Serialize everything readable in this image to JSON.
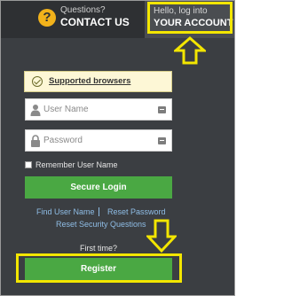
{
  "header": {
    "questions_label": "Questions?",
    "contact_label": "CONTACT US",
    "account_small": "Hello, log into",
    "account_big": "YOUR ACCOUNT"
  },
  "browsers": {
    "label": "Supported browsers"
  },
  "form": {
    "username_placeholder": "User Name",
    "password_placeholder": "Password",
    "remember_label": "Remember User Name",
    "login_label": "Secure Login"
  },
  "links": {
    "find_user": "Find User Name",
    "divider": "|",
    "reset_password": "Reset Password",
    "reset_questions": "Reset Security Questions"
  },
  "register": {
    "prompt": "First time?",
    "button_label": "Register"
  },
  "colors": {
    "highlight": "#f3e600",
    "button_green": "#4aa843",
    "background": "#3b3e42",
    "link": "#8fbde6"
  }
}
